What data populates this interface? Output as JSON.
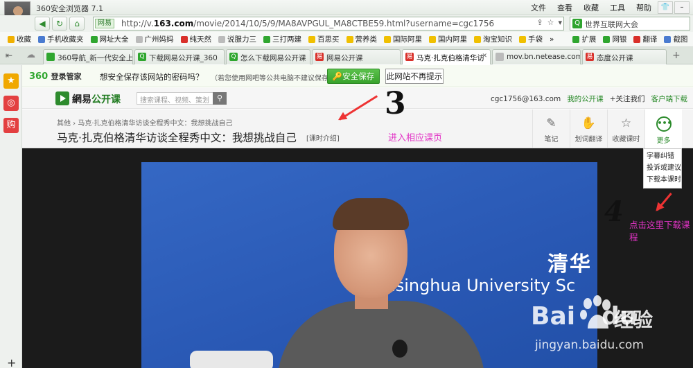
{
  "browser": {
    "title": "360安全浏览器 7.1",
    "menu": [
      "文件",
      "查看",
      "收藏",
      "工具",
      "帮助"
    ],
    "url_tag": "网易",
    "url_prefix": "http://v.",
    "url_domain": "163.com",
    "url_path": "/movie/2014/10/5/9/MA8AVPGUL_MA8CTBE59.html?username=cgc1756",
    "search_text": "世界互联网大会",
    "bookmarks": [
      "收藏",
      "手机收藏夹",
      "网址大全",
      "广州妈妈",
      "纯天然",
      "说服力三",
      "三打两建",
      "百思买",
      "营养类",
      "国际阿里",
      "国内阿里",
      "淘宝知识",
      "手袋"
    ],
    "bookmarks_right": [
      "扩展",
      "网银",
      "翻译",
      "截图"
    ],
    "tabs": [
      {
        "label": "360导航_新一代安全上",
        "color": "#2fa62f"
      },
      {
        "label": "下载网易公开课_360",
        "color": "#2fa62f"
      },
      {
        "label": "怎么下载网易公开课",
        "color": "#2fa62f"
      },
      {
        "label": "网易公开课",
        "color": "#d9302a"
      },
      {
        "label": "马克·扎克伯格清华访",
        "color": "#d9302a"
      },
      {
        "label": "mov.bn.netease.com",
        "color": "#888888"
      },
      {
        "label": "态度公开课",
        "color": "#d9302a"
      }
    ]
  },
  "password_bar": {
    "logo": "360",
    "logo_sub": "登录管家",
    "question": "想安全保存该网站的密码吗？",
    "note": "（若您使用网吧等公共电脑不建议保存）",
    "save_label": "安全保存",
    "never_label": "此网站不再提示"
  },
  "site": {
    "logo_a": "網易",
    "logo_b": "公开课",
    "search_placeholder": "搜索课程、视频、策划",
    "user": "cgc1756@163.com",
    "my_courses": "我的公开课",
    "follow": "+关注我们",
    "client_download": "客户端下载"
  },
  "course": {
    "breadcrumb": "其他 › 马克·扎克伯格清华访谈全程秀中文：我想挑战自己",
    "title": "马克·扎克伯格清华访谈全程秀中文：我想挑战自己",
    "intro": "[课时介绍]",
    "tools": [
      "笔记",
      "划词翻译",
      "收藏课时",
      "更多"
    ],
    "more_menu": [
      "字幕纠错",
      "投诉或建议",
      "下载本课时"
    ]
  },
  "video": {
    "banner_cn": "清华",
    "banner_en": "Tsinghua University Sc"
  },
  "annotations": {
    "step3": "3",
    "step3_text": "进入相应课页",
    "step4": "4",
    "step4_text": "点击这里下载课程"
  },
  "watermark": {
    "brand": "Bai",
    "brand2": "du",
    "cn": "经验",
    "url": "jingyan.baidu.com"
  }
}
